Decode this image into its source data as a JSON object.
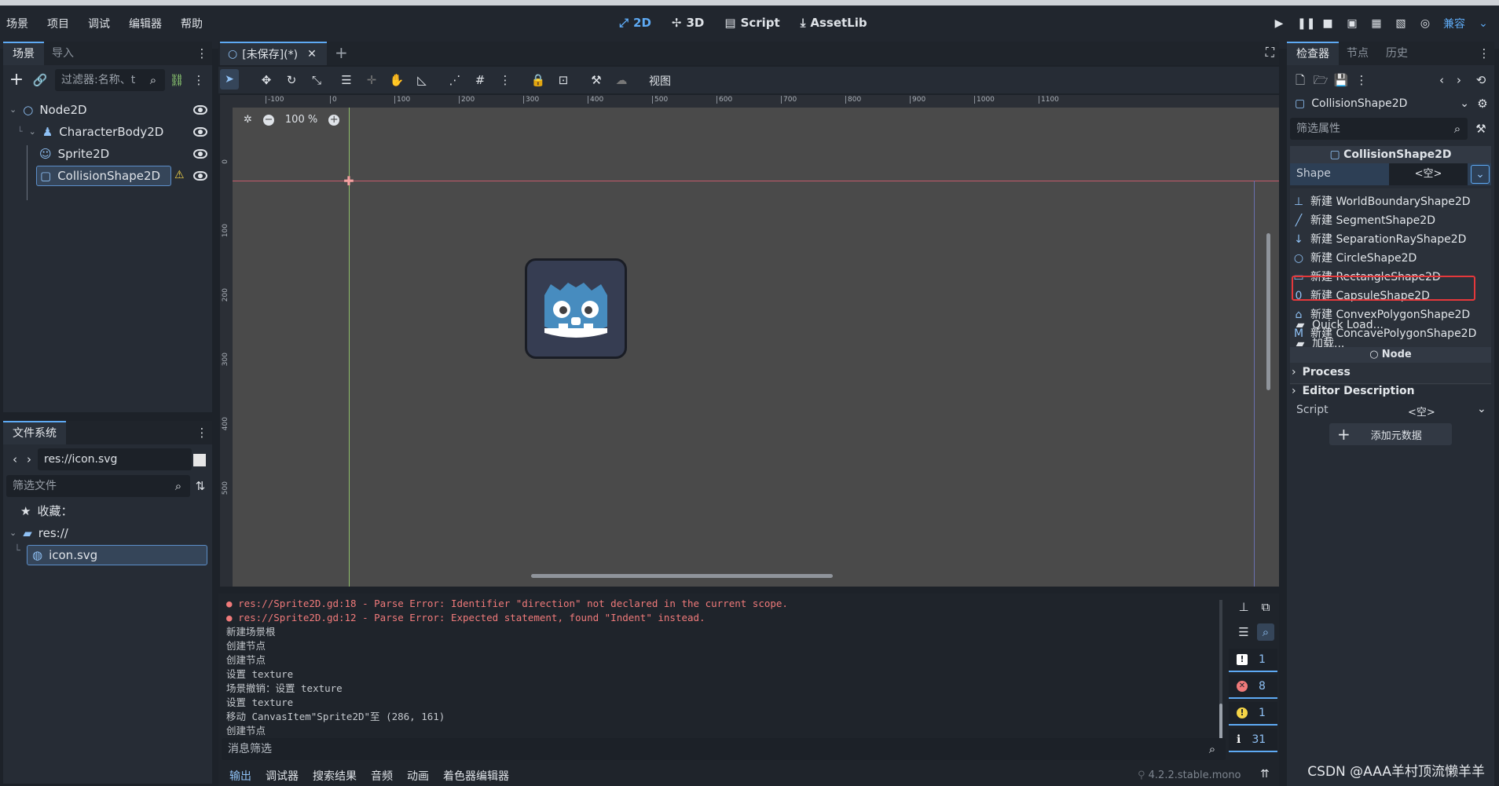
{
  "menu": {
    "items": [
      "场景",
      "项目",
      "调试",
      "编辑器",
      "帮助"
    ]
  },
  "modes": {
    "m2d": "2D",
    "m3d": "3D",
    "script": "Script",
    "assetlib": "AssetLib"
  },
  "run": {
    "compat": "兼容"
  },
  "scene_panel": {
    "tab_scene": "场景",
    "tab_import": "导入",
    "filter_placeholder": "过滤器:名称、t",
    "nodes": [
      {
        "label": "Node2D",
        "icon": "circle-icon"
      },
      {
        "label": "CharacterBody2D",
        "icon": "body-icon"
      },
      {
        "label": "Sprite2D",
        "icon": "sprite-icon"
      },
      {
        "label": "CollisionShape2D",
        "icon": "rect-icon"
      }
    ]
  },
  "fs_panel": {
    "title": "文件系统",
    "path": "res://icon.svg",
    "filter_placeholder": "筛选文件",
    "favorites": "收藏：",
    "root": "res://",
    "file": "icon.svg"
  },
  "editor": {
    "tab_label": "[未保存](*)",
    "view_menu": "视图",
    "zoom": "100 %",
    "ruler_labels": [
      "-100",
      "0",
      "100",
      "200",
      "300",
      "400",
      "500",
      "600",
      "700",
      "800",
      "900",
      "1000",
      "1100"
    ],
    "ruler_v_labels": [
      "0",
      "100",
      "200",
      "300",
      "400",
      "500"
    ]
  },
  "console": {
    "lines": [
      {
        "text": "res://Sprite2D.gd:18 - Parse Error: Identifier \"direction\" not declared in the current scope.",
        "err": true
      },
      {
        "text": "res://Sprite2D.gd:12 - Parse Error: Expected statement, found \"Indent\" instead.",
        "err": true
      },
      {
        "text": "新建场景根",
        "err": false
      },
      {
        "text": "创建节点",
        "err": false
      },
      {
        "text": "创建节点",
        "err": false
      },
      {
        "text": "设置 texture",
        "err": false
      },
      {
        "text": "场景撤销：设置 texture",
        "err": false
      },
      {
        "text": "设置 texture",
        "err": false
      },
      {
        "text": "移动 CanvasItem\"Sprite2D\"至 (286, 161)",
        "err": false
      },
      {
        "text": "创建节点",
        "err": false
      }
    ],
    "filter_placeholder": "消息筛选",
    "counts": {
      "messages": "1",
      "errors": "8",
      "warnings": "1",
      "info": "31"
    },
    "bottom_tabs": [
      "输出",
      "调试器",
      "搜索结果",
      "音频",
      "动画",
      "着色器编辑器"
    ],
    "version": "4.2.2.stable.mono"
  },
  "inspector": {
    "tab_inspector": "检查器",
    "tab_node": "节点",
    "tab_history": "历史",
    "object": "CollisionShape2D",
    "filter_placeholder": "筛选属性",
    "section": "CollisionShape2D",
    "shape_label": "Shape",
    "shape_value": "<空>",
    "dropdown": [
      {
        "label": "新建 WorldBoundaryShape2D",
        "icon": "world-boundary-icon",
        "glyph": "⊥"
      },
      {
        "label": "新建 SegmentShape2D",
        "icon": "segment-icon",
        "glyph": "╱"
      },
      {
        "label": "新建 SeparationRayShape2D",
        "icon": "separation-ray-icon",
        "glyph": "↓"
      },
      {
        "label": "新建 CircleShape2D",
        "icon": "circle-shape-icon",
        "glyph": "○"
      },
      {
        "label": "新建 RectangleShape2D",
        "icon": "rectangle-shape-icon",
        "glyph": "▭"
      },
      {
        "label": "新建 CapsuleShape2D",
        "icon": "capsule-shape-icon",
        "glyph": "0"
      },
      {
        "label": "新建 ConvexPolygonShape2D",
        "icon": "convex-polygon-icon",
        "glyph": "⌂"
      },
      {
        "label": "新建 ConcavePolygonShape2D",
        "icon": "concave-polygon-icon",
        "glyph": "M"
      }
    ],
    "quick_load": "Quick Load...",
    "load": "加载...",
    "node_section": "Node",
    "process": "Process",
    "editor_desc": "Editor Description",
    "script_label": "Script",
    "script_value": "<空>",
    "add_meta": "添加元数据"
  },
  "watermark": "CSDN @AAA羊村顶流懒羊羊",
  "colors": {
    "accent": "#5eaaf4",
    "highlight": "#e5383b",
    "error": "#f07a7a"
  }
}
